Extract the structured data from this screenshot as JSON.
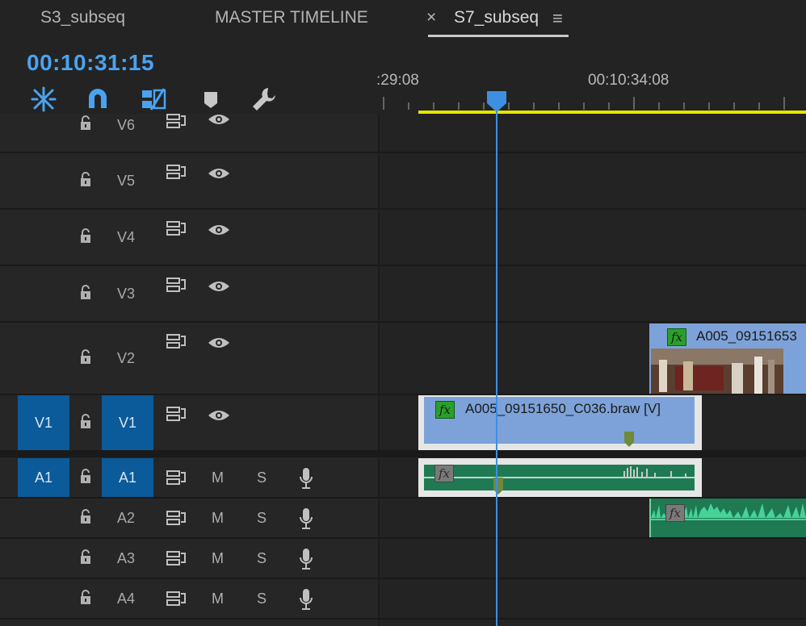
{
  "tabs": {
    "items": [
      {
        "label": "S3_subseq"
      },
      {
        "label": "MASTER TIMELINE"
      },
      {
        "label": "S7_subseq",
        "close": "×",
        "menu": "≡",
        "active": true
      }
    ]
  },
  "timecode": "00:10:31:15",
  "toolbar": {
    "icons": [
      "snap-insert-icon",
      "magnet-icon",
      "linked-selection-icon",
      "add-marker-icon",
      "wrench-icon"
    ]
  },
  "ruler": {
    "labels": [
      ":29:08",
      "00:10:34:08"
    ]
  },
  "video_tracks": [
    {
      "name": "V6"
    },
    {
      "name": "V5"
    },
    {
      "name": "V4"
    },
    {
      "name": "V3"
    },
    {
      "name": "V2"
    },
    {
      "name": "V1",
      "source": "V1"
    }
  ],
  "audio_tracks": [
    {
      "name": "A1",
      "source": "A1",
      "mute": "M",
      "solo": "S"
    },
    {
      "name": "A2",
      "mute": "M",
      "solo": "S"
    },
    {
      "name": "A3",
      "mute": "M",
      "solo": "S"
    },
    {
      "name": "A4",
      "mute": "M",
      "solo": "S"
    }
  ],
  "clips": {
    "fx_label": "fx",
    "v2_clip": "A005_09151653",
    "v1_clip": "A005_09151650_C036.braw [V]"
  },
  "colors": {
    "accent": "#4aa3f0",
    "target_box": "#0b5a9a",
    "video_clip": "#7da2d9",
    "audio_clip": "#1f7a54",
    "work_area": "#e6e600"
  }
}
